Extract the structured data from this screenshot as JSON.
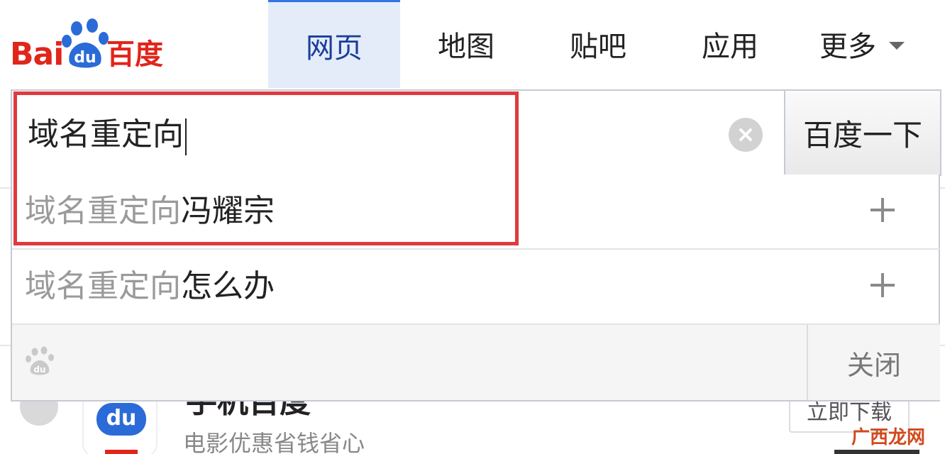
{
  "logo": {
    "text_latin": "Bai",
    "text_du": "du",
    "text_cn": "百度"
  },
  "nav": {
    "items": [
      {
        "label": "网页",
        "active": true
      },
      {
        "label": "地图",
        "active": false
      },
      {
        "label": "贴吧",
        "active": false
      },
      {
        "label": "应用",
        "active": false
      },
      {
        "label": "更多",
        "active": false
      }
    ]
  },
  "search": {
    "value": "域名重定向",
    "clear_icon": "×",
    "submit_label": "百度一下"
  },
  "suggestions": [
    {
      "query": "域名重定向",
      "completion": "冯耀宗"
    },
    {
      "query": "域名重定向",
      "completion": "怎么办"
    }
  ],
  "dropdown_footer": {
    "close_label": "关闭"
  },
  "background_app": {
    "title": "手机百度",
    "subtitle": "电影优惠省钱省心",
    "download_label": "立即下载",
    "icon_text": "du"
  },
  "watermark": "广西龙网",
  "colors": {
    "brand_red": "#e1251b",
    "brand_blue": "#2b6bd8",
    "annotation_red": "#e0393e"
  }
}
